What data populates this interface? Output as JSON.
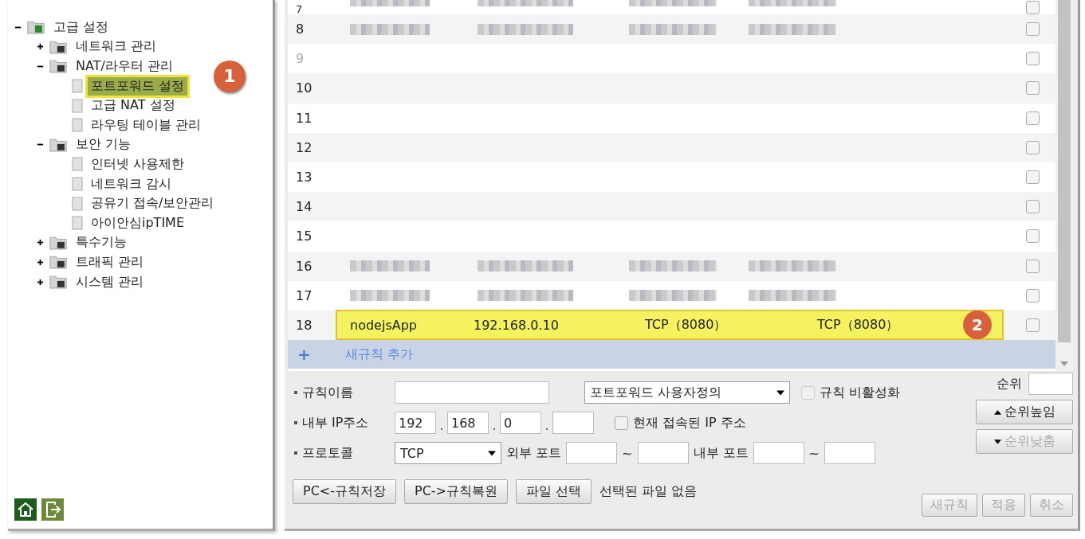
{
  "tree": [
    {
      "label": "고급 설정",
      "expanded": true,
      "children": [
        {
          "label": "네트워크 관리",
          "expanded": false
        },
        {
          "label": "NAT/라우터 관리",
          "expanded": true,
          "children": [
            {
              "label": "포트포워드 설정",
              "selected": true,
              "badge": "1"
            },
            {
              "label": "고급 NAT 설정",
              "selected": false
            },
            {
              "label": "라우팅 테이블 관리",
              "selected": false
            }
          ]
        },
        {
          "label": "보안 기능",
          "expanded": true,
          "children": [
            {
              "label": "인터넷 사용제한",
              "selected": false
            },
            {
              "label": "네트워크 감시",
              "selected": false
            },
            {
              "label": "공유기 접속/보안관리",
              "selected": false
            },
            {
              "label": "아이안심ipTIME",
              "selected": false
            }
          ]
        },
        {
          "label": "특수기능",
          "expanded": false
        },
        {
          "label": "트래픽 관리",
          "expanded": false
        },
        {
          "label": "시스템 관리",
          "expanded": false
        }
      ]
    }
  ],
  "rules": [
    {
      "no": "7",
      "blurred": true,
      "selected": false,
      "checked": false,
      "disabled": false
    },
    {
      "no": "8",
      "blurred": true,
      "selected": false,
      "checked": false,
      "disabled": false
    },
    {
      "no": "9",
      "blurred": false,
      "selected": false,
      "checked": false,
      "disabled": true
    },
    {
      "no": "10",
      "blurred": false,
      "selected": false,
      "checked": false,
      "disabled": false
    },
    {
      "no": "11",
      "blurred": false,
      "selected": false,
      "checked": false,
      "disabled": false
    },
    {
      "no": "12",
      "blurred": false,
      "selected": false,
      "checked": false,
      "disabled": false
    },
    {
      "no": "13",
      "blurred": false,
      "selected": false,
      "checked": false,
      "disabled": false
    },
    {
      "no": "14",
      "blurred": false,
      "selected": false,
      "checked": false,
      "disabled": false
    },
    {
      "no": "15",
      "blurred": false,
      "selected": false,
      "checked": false,
      "disabled": false
    },
    {
      "no": "16",
      "blurred": true,
      "selected": false,
      "checked": false,
      "disabled": false
    },
    {
      "no": "17",
      "blurred": true,
      "selected": false,
      "checked": false,
      "disabled": false
    },
    {
      "no": "18",
      "blurred": false,
      "selected": true,
      "checked": false,
      "disabled": false,
      "badge": "2",
      "name": "nodejsApp",
      "ip": "192.168.0.10",
      "external": "TCP（8080）",
      "internal": "TCP（8080）"
    }
  ],
  "add_rule": {
    "plus": "+",
    "label": "새규칙 추가"
  },
  "form": {
    "name_label": "규칙이름",
    "preset": "포트포워드 사용자정의",
    "disable_label": "규칙 비활성화",
    "disable_checked": false,
    "ip_label": "내부 IP주소",
    "ip": [
      "192",
      "168",
      "0"
    ],
    "current_ip_label": "현재 접속된 IP 주소",
    "current_ip_checked": false,
    "protocol_label": "프로토콜",
    "protocol": "TCP",
    "ext_port_label": "외부 포트",
    "int_port_label": "내부 포트",
    "tilde": "~"
  },
  "order": {
    "label": "순위",
    "up": "순위높임",
    "down": "순위낮춤",
    "down_disabled": true
  },
  "file_buttons": [
    "PC<-규칙저장",
    "PC->규칙복원",
    "파일 선택"
  ],
  "file_status": "선택된 파일 없음",
  "actions": [
    {
      "label": "새규칙",
      "disabled": true
    },
    {
      "label": "적용",
      "disabled": true
    },
    {
      "label": "취소",
      "disabled": true
    }
  ]
}
